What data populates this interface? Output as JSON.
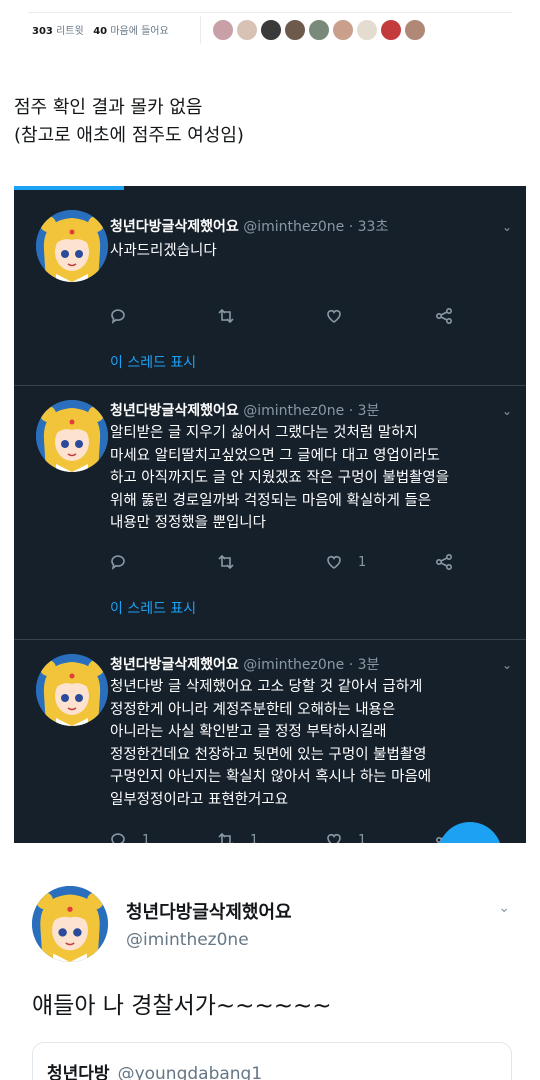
{
  "stats": {
    "retweets": "303",
    "retweets_label": "리트윗",
    "likes": "40",
    "likes_label": "마음에 들어요"
  },
  "liker_colors": [
    "#c9a0a8",
    "#d8c2b5",
    "#3a3a3a",
    "#6d5a4c",
    "#7a8a7a",
    "#caa08c",
    "#e4dccf",
    "#c43b3b",
    "#b08878"
  ],
  "caption": {
    "line1": "점주 확인 결과 몰카 없음",
    "line2": "(참고로 애초에 점주도 여성임)"
  },
  "tweets": [
    {
      "name": "청년다방글삭제했어요",
      "handle": "@iminthez0ne",
      "time": "· 33초",
      "lines": [
        "사과드리겠습니다"
      ],
      "reply_count": "",
      "retweet_count": "",
      "like_count": "",
      "thread_label": "이 스레드 표시"
    },
    {
      "name": "청년다방글삭제했어요",
      "handle": "@iminthez0ne",
      "time": "· 3분",
      "lines": [
        "알티받은 글 지우기 싫어서 그랬다는 것처럼 말하지",
        "마세요 알티딸치고싶었으면 그 글에다 대고 영업이라도",
        "하고 아직까지도 글 안 지웠겠죠 작은 구멍이 불법촬영을",
        "위해 뚫린 경로일까봐 걱정되는 마음에 확실하게 들은",
        "내용만 정정했을 뿐입니다"
      ],
      "reply_count": "",
      "retweet_count": "",
      "like_count": "1",
      "thread_label": "이 스레드 표시"
    },
    {
      "name": "청년다방글삭제했어요",
      "handle": "@iminthez0ne",
      "time": "· 3분",
      "lines": [
        "청년다방 글 삭제했어요 고소 당할 것 같아서 급하게",
        "정정한게 아니라 계정주분한테 오해하는 내용은",
        "아니라는 사실 확인받고 글 정정 부탁하시길래",
        "정정한건데요 천장하고 뒷면에 있는 구멍이 불법촬영",
        "구멍인지 아닌지는 확실치 않아서 혹시나 하는 마음에",
        "일부정정이라고 표현한거고요"
      ],
      "reply_count": "1",
      "retweet_count": "1",
      "like_count": "1",
      "thread_label": ""
    }
  ],
  "bottom": {
    "name": "청년다방글삭제했어요",
    "handle": "@iminthez0ne",
    "text": "얘들아 나 경찰서가~~~~~~",
    "quote_name": "청년다방",
    "quote_handle": "@youngdabang1"
  }
}
